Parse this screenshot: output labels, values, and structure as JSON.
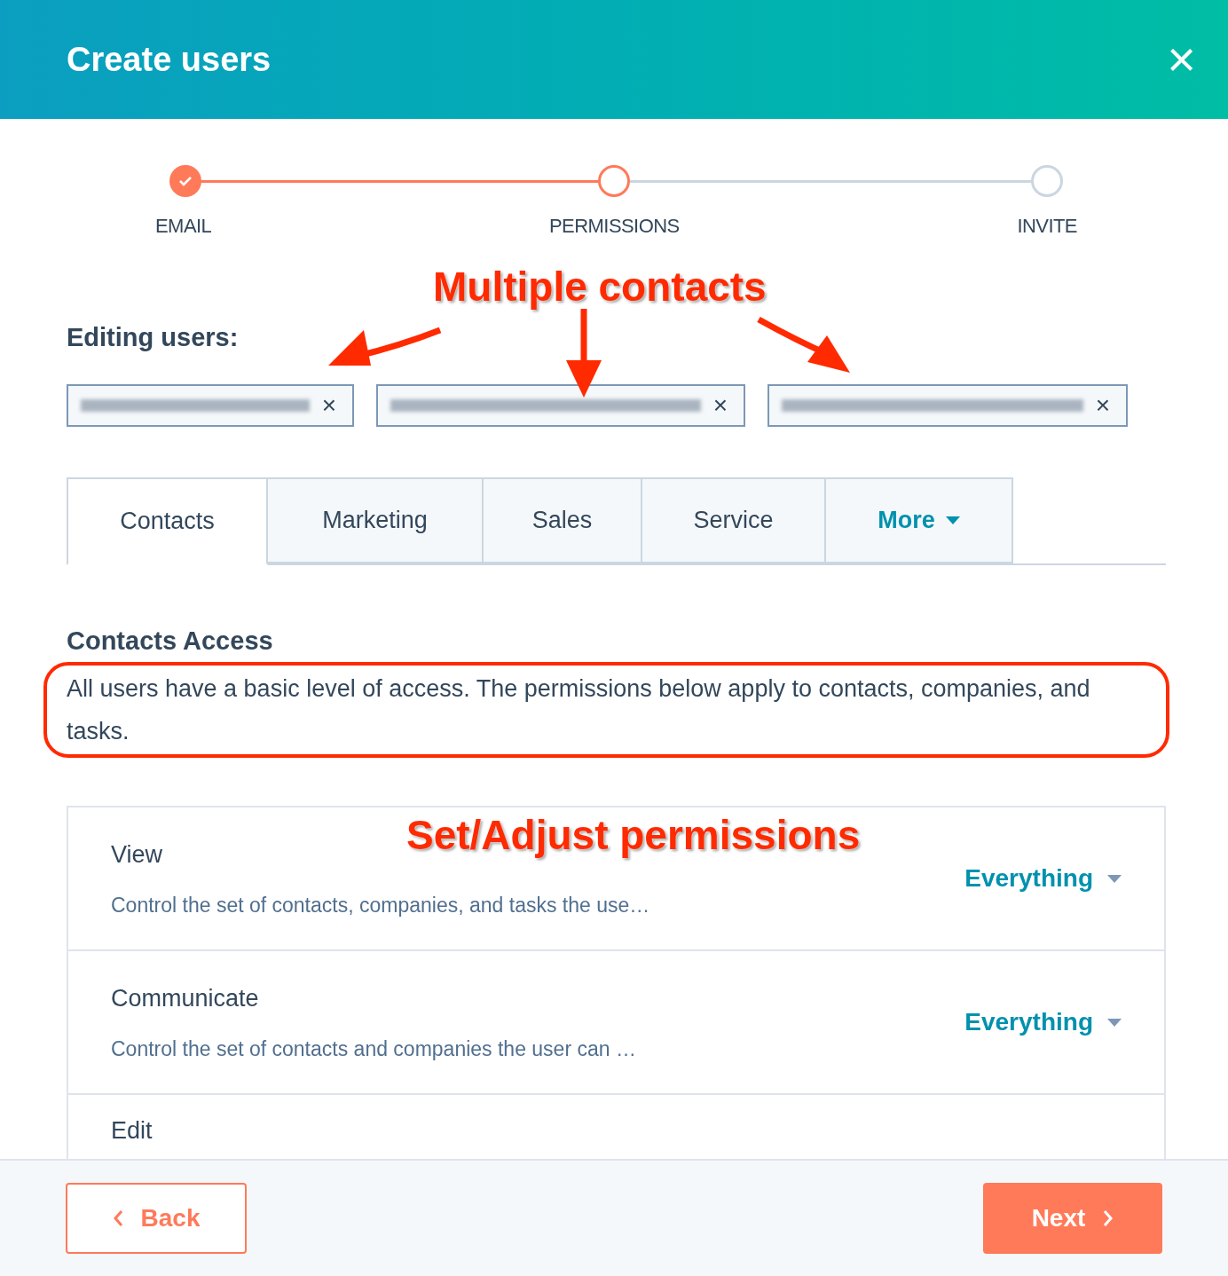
{
  "window": {
    "title": "Create users",
    "close": "×"
  },
  "steps": [
    {
      "label": "EMAIL",
      "completed": true,
      "selected": false
    },
    {
      "label": "PERMISSIONS",
      "completed": false,
      "selected": true
    },
    {
      "label": "INVITE",
      "completed": false,
      "selected": false
    }
  ],
  "editing": {
    "label": "Editing users:",
    "chips": [
      {
        "kind": "redacted",
        "remove": "×"
      },
      {
        "kind": "redacted",
        "remove": "×"
      },
      {
        "kind": "redacted",
        "remove": "×"
      }
    ]
  },
  "tabs": [
    {
      "label": "Contacts",
      "selected": true,
      "kind": "tab"
    },
    {
      "label": "Marketing",
      "selected": false,
      "kind": "tab"
    },
    {
      "label": "Sales",
      "selected": false,
      "kind": "tab"
    },
    {
      "label": "Service",
      "selected": false,
      "kind": "tab"
    },
    {
      "label": "More",
      "selected": false,
      "kind": "dropdown"
    }
  ],
  "section": {
    "title": "Contacts Access",
    "description": "All users have a basic level of access. The permissions below apply to contacts, companies, and tasks."
  },
  "permissions": [
    {
      "title": "View",
      "description": "Control the set of contacts, companies, and tasks the use…",
      "value": "Everything"
    },
    {
      "title": "Communicate",
      "description": "Control the set of contacts and companies the user can …",
      "value": "Everything"
    },
    {
      "title": "Edit"
    }
  ],
  "footer": {
    "back": "Back",
    "next": "Next"
  },
  "annotations": {
    "callout": "Multiple contacts",
    "note": "Set/Adjust permissions"
  }
}
